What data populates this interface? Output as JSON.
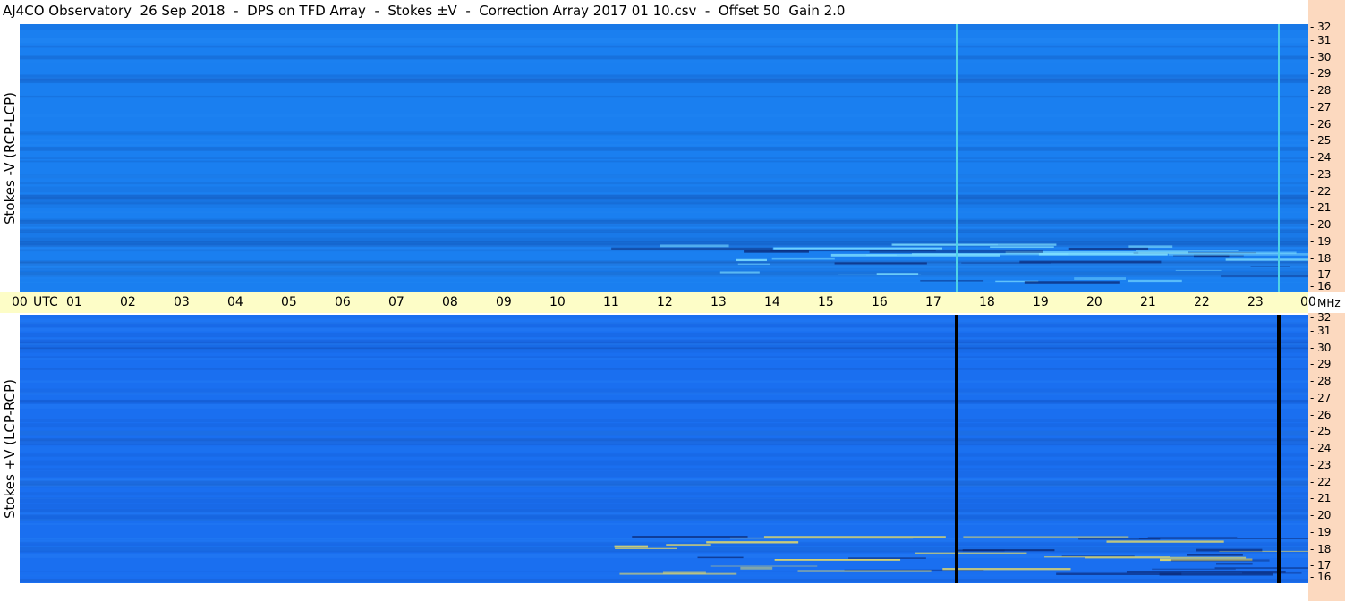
{
  "title": "AJ4CO Observatory  26 Sep 2018  -  DPS on TFD Array  -  Stokes ±V  -  Correction Array 2017 01 10.csv  -  Offset 50  Gain 2.0",
  "chart_data": [
    {
      "type": "heatmap",
      "panel": "top",
      "ylabel": "Stokes -V  (RCP-LCP)",
      "x_ticks": [
        "00",
        "01",
        "02",
        "03",
        "04",
        "05",
        "06",
        "07",
        "08",
        "09",
        "10",
        "11",
        "12",
        "13",
        "14",
        "15",
        "16",
        "17",
        "18",
        "19",
        "20",
        "21",
        "22",
        "23",
        "00"
      ],
      "x_unit": "UTC",
      "y_ticks": [
        "32",
        "31",
        "30",
        "29",
        "28",
        "27",
        "26",
        "25",
        "24",
        "23",
        "22",
        "21",
        "20",
        "19",
        "18",
        "17",
        "16"
      ],
      "y_unit": "MHz",
      "xlim": [
        0,
        24
      ],
      "ylim": [
        16,
        32
      ],
      "vertical_lines_utc": [
        17.45,
        23.45
      ],
      "vertical_line_color": "#4fd2e6",
      "colors": {
        "background": "#1a7ff0",
        "low": "#0a2a7a",
        "high": "#7fe0ff"
      }
    },
    {
      "type": "heatmap",
      "panel": "bottom",
      "ylabel": "Stokes +V  (LCP-RCP)",
      "x_ticks": [
        "00",
        "01",
        "02",
        "03",
        "04",
        "05",
        "06",
        "07",
        "08",
        "09",
        "10",
        "11",
        "12",
        "13",
        "14",
        "15",
        "16",
        "17",
        "18",
        "19",
        "20",
        "21",
        "22",
        "23",
        "00"
      ],
      "x_unit": "UTC",
      "y_ticks": [
        "32",
        "31",
        "30",
        "29",
        "28",
        "27",
        "26",
        "25",
        "24",
        "23",
        "22",
        "21",
        "20",
        "19",
        "18",
        "17",
        "16"
      ],
      "y_unit": "MHz",
      "xlim": [
        0,
        24
      ],
      "ylim": [
        16,
        32
      ],
      "vertical_lines_utc": [
        17.45,
        23.45
      ],
      "vertical_line_color": "#000000",
      "colors": {
        "background": "#1a6ff0",
        "low": "#0a2a7a",
        "high": "#f0e060"
      }
    }
  ]
}
